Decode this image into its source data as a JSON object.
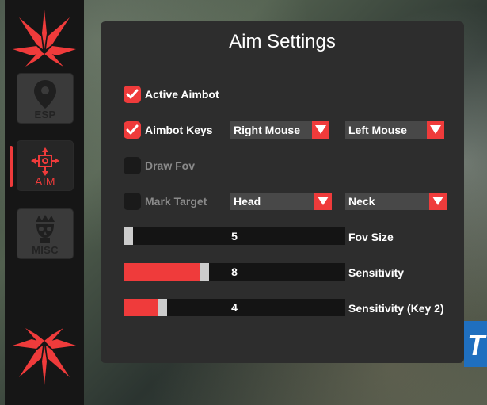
{
  "colors": {
    "accent": "#ef3b3b",
    "panel": "#2d2d2d",
    "sidebar": "#161616"
  },
  "sidebar": {
    "items": [
      {
        "label": "ESP",
        "icon": "map-pin-icon",
        "active": false
      },
      {
        "label": "AIM",
        "icon": "crosshair-icon",
        "active": true
      },
      {
        "label": "MISC",
        "icon": "skull-icon",
        "active": false
      }
    ]
  },
  "panel": {
    "title": "Aim Settings",
    "active_aimbot": {
      "label": "Active Aimbot",
      "checked": true
    },
    "aimbot_keys": {
      "label": "Aimbot Keys",
      "checked": true,
      "key1": "Right Mouse",
      "key2": "Left Mouse"
    },
    "draw_fov": {
      "label": "Draw Fov",
      "checked": false
    },
    "mark_target": {
      "label": "Mark Target",
      "checked": false,
      "target1": "Head",
      "target2": "Neck"
    },
    "sliders": [
      {
        "label": "Fov Size",
        "value": "5",
        "fraction": 0.0
      },
      {
        "label": "Sensitivity",
        "value": "8",
        "fraction": 0.36
      },
      {
        "label": "Sensitivity (Key 2)",
        "value": "4",
        "fraction": 0.16
      }
    ]
  }
}
